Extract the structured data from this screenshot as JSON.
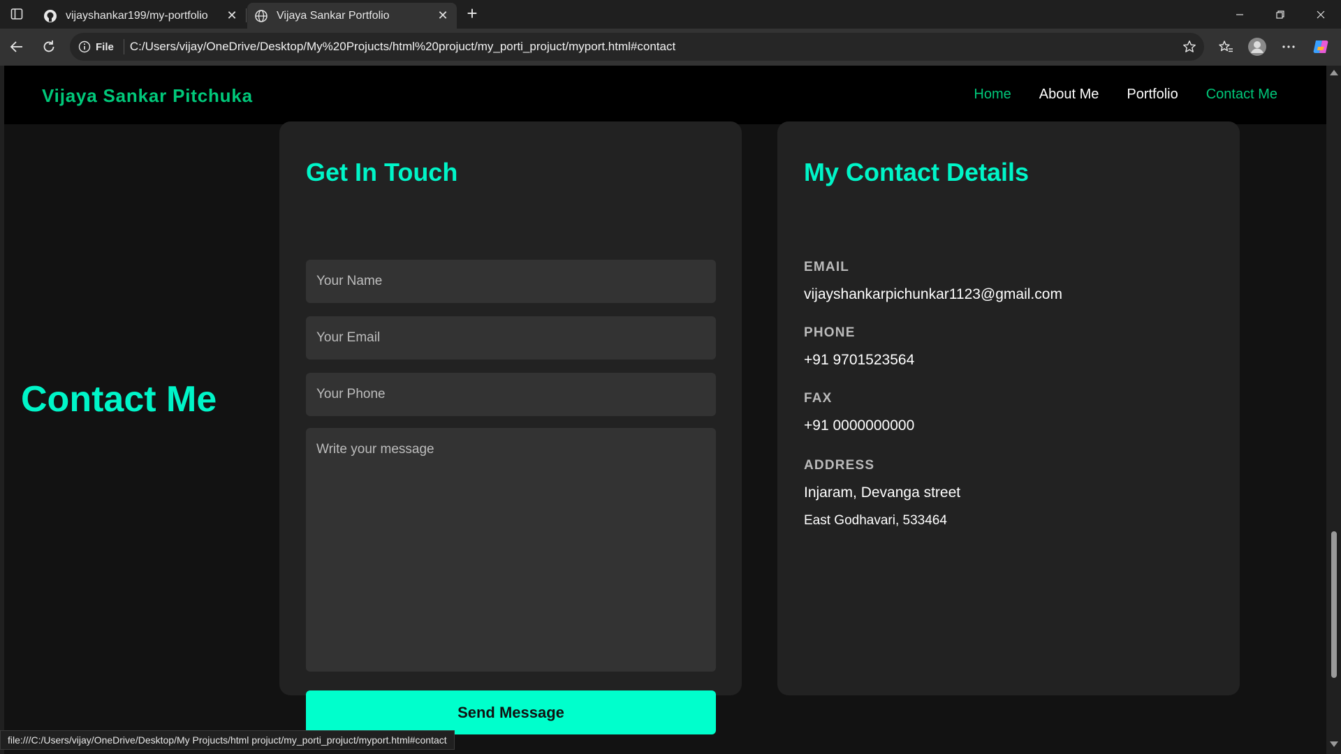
{
  "browser": {
    "tabs": [
      {
        "title": "vijayshankar199/my-portfolio",
        "icon": "github-icon",
        "active": false
      },
      {
        "title": "Vijaya Sankar Portfolio",
        "icon": "globe-icon",
        "active": true
      }
    ],
    "address_prefix": "File",
    "url": "C:/Users/vijay/OneDrive/Desktop/My%20Projucts/html%20projuct/my_porti_projuct/myport.html#contact",
    "status_url": "file:///C:/Users/vijay/OneDrive/Desktop/My Projucts/html projuct/my_porti_projuct/myport.html#contact"
  },
  "header": {
    "brand": "Vijaya Sankar Pitchuka",
    "nav": [
      {
        "label": "Home"
      },
      {
        "label": "About Me"
      },
      {
        "label": "Portfolio"
      },
      {
        "label": "Contact Me"
      }
    ]
  },
  "section": {
    "title": "Contact Me"
  },
  "form": {
    "title": "Get In Touch",
    "name_placeholder": "Your Name",
    "email_placeholder": "Your Email",
    "phone_placeholder": "Your Phone",
    "message_placeholder": "Write your message",
    "submit_label": "Send Message"
  },
  "details": {
    "title": "My Contact Details",
    "email_label": "EMAIL",
    "email_value": "vijayshankarpichunkar1123@gmail.com",
    "phone_label": "PHONE",
    "phone_value": "+91 9701523564",
    "fax_label": "FAX",
    "fax_value": "+91 0000000000",
    "address_label": "ADDRESS",
    "address_line1": "Injaram, Devanga street",
    "address_line2": "East Godhavari, 533464"
  },
  "colors": {
    "accent": "#00f5c8",
    "brand_green": "#00c87a",
    "button": "#00ffcc",
    "card": "#222222",
    "page_bg": "#121212"
  }
}
